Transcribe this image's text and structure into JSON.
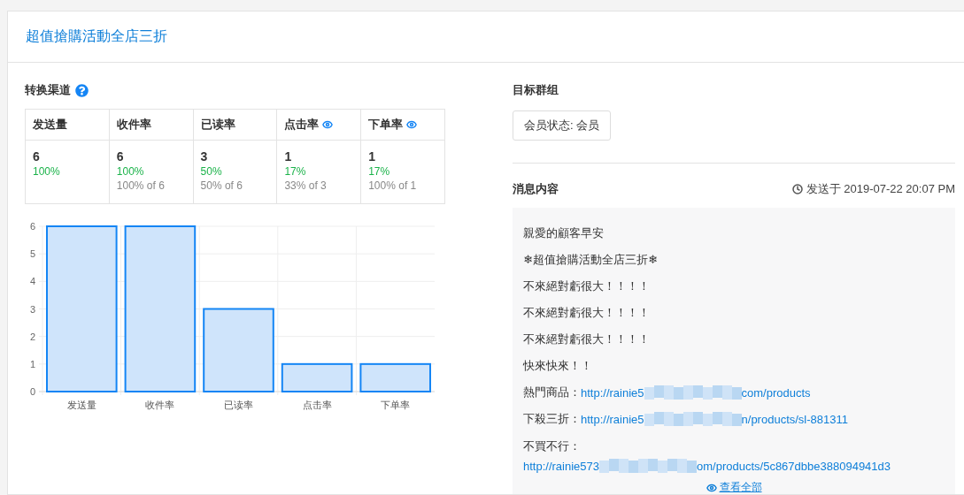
{
  "title": "超值搶購活動全店三折",
  "funnel": {
    "heading": "转换渠道",
    "columns": [
      {
        "label": "发送量",
        "eye": false,
        "count": "6",
        "rate": "100%"
      },
      {
        "label": "收件率",
        "eye": false,
        "count": "6",
        "rate": "100%",
        "of": "100% of 6"
      },
      {
        "label": "已读率",
        "eye": false,
        "count": "3",
        "rate": "50%",
        "of": "50% of 6"
      },
      {
        "label": "点击率",
        "eye": true,
        "count": "1",
        "rate": "17%",
        "of": "33% of 3"
      },
      {
        "label": "下单率",
        "eye": true,
        "count": "1",
        "rate": "17%",
        "of": "100% of 1"
      }
    ],
    "chart_data": {
      "type": "bar",
      "categories": [
        "发送量",
        "收件率",
        "已读率",
        "点击率",
        "下单率"
      ],
      "values": [
        6,
        6,
        3,
        1,
        1
      ],
      "ylim": [
        0,
        6
      ],
      "yticks": [
        0,
        1,
        2,
        3,
        4,
        5,
        6
      ],
      "grid": true
    }
  },
  "target": {
    "heading": "目标群组",
    "tags": [
      "会员状态: 会员"
    ]
  },
  "message": {
    "heading": "消息内容",
    "sent": "发送于 2019-07-22 20:07 PM",
    "lines": [
      {
        "kind": "text",
        "text": "親愛的顧客早安"
      },
      {
        "kind": "text",
        "text": "❄超值搶購活動全店三折❄"
      },
      {
        "kind": "text",
        "text": "不來絕對虧很大！！！！"
      },
      {
        "kind": "text",
        "text": "不來絕對虧很大！！！！"
      },
      {
        "kind": "text",
        "text": "不來絕對虧很大！！！！"
      },
      {
        "kind": "text",
        "text": "快來快來！！"
      },
      {
        "kind": "link",
        "label": "熱門商品：",
        "url_start": "http://rainie5",
        "url_end": "com/products",
        "wrap": false
      },
      {
        "kind": "link",
        "label": "下殺三折：",
        "url_start": "http://rainie5",
        "url_end": "n/products/sl-881311",
        "wrap": false
      },
      {
        "kind": "link",
        "label": "不買不行：",
        "url_start": "http://rainie573",
        "url_end": "om/products/5c867dbbe388094941d3",
        "wrap": true
      }
    ],
    "view_all": "查看全部"
  }
}
